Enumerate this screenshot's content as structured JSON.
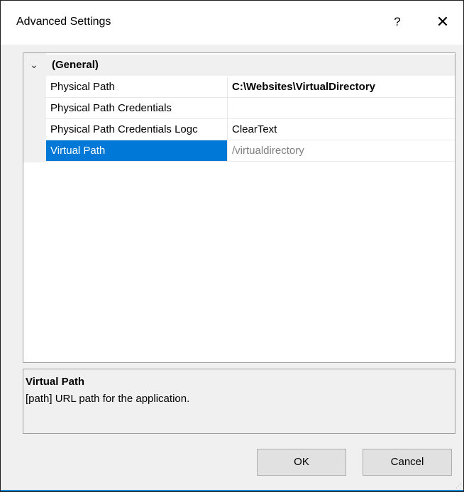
{
  "dialog": {
    "title": "Advanced Settings",
    "help_label": "?",
    "close_label": "✕"
  },
  "grid": {
    "category": {
      "label": "(General)",
      "chevron": "⌄"
    },
    "properties": [
      {
        "name": "Physical Path",
        "value": "C:\\Websites\\VirtualDirectory",
        "value_style": "bold"
      },
      {
        "name": "Physical Path Credentials",
        "value": ""
      },
      {
        "name": "Physical Path Credentials Logc",
        "value": "ClearText"
      },
      {
        "name": "Virtual Path",
        "value": "/virtualdirectory",
        "value_style": "muted",
        "selected": true
      }
    ]
  },
  "description": {
    "title": "Virtual Path",
    "text": "[path] URL path for the application."
  },
  "buttons": {
    "ok_label": "OK",
    "cancel_label": "Cancel"
  },
  "colors": {
    "selection": "#0078d7",
    "accent": "#1a8ad4"
  }
}
